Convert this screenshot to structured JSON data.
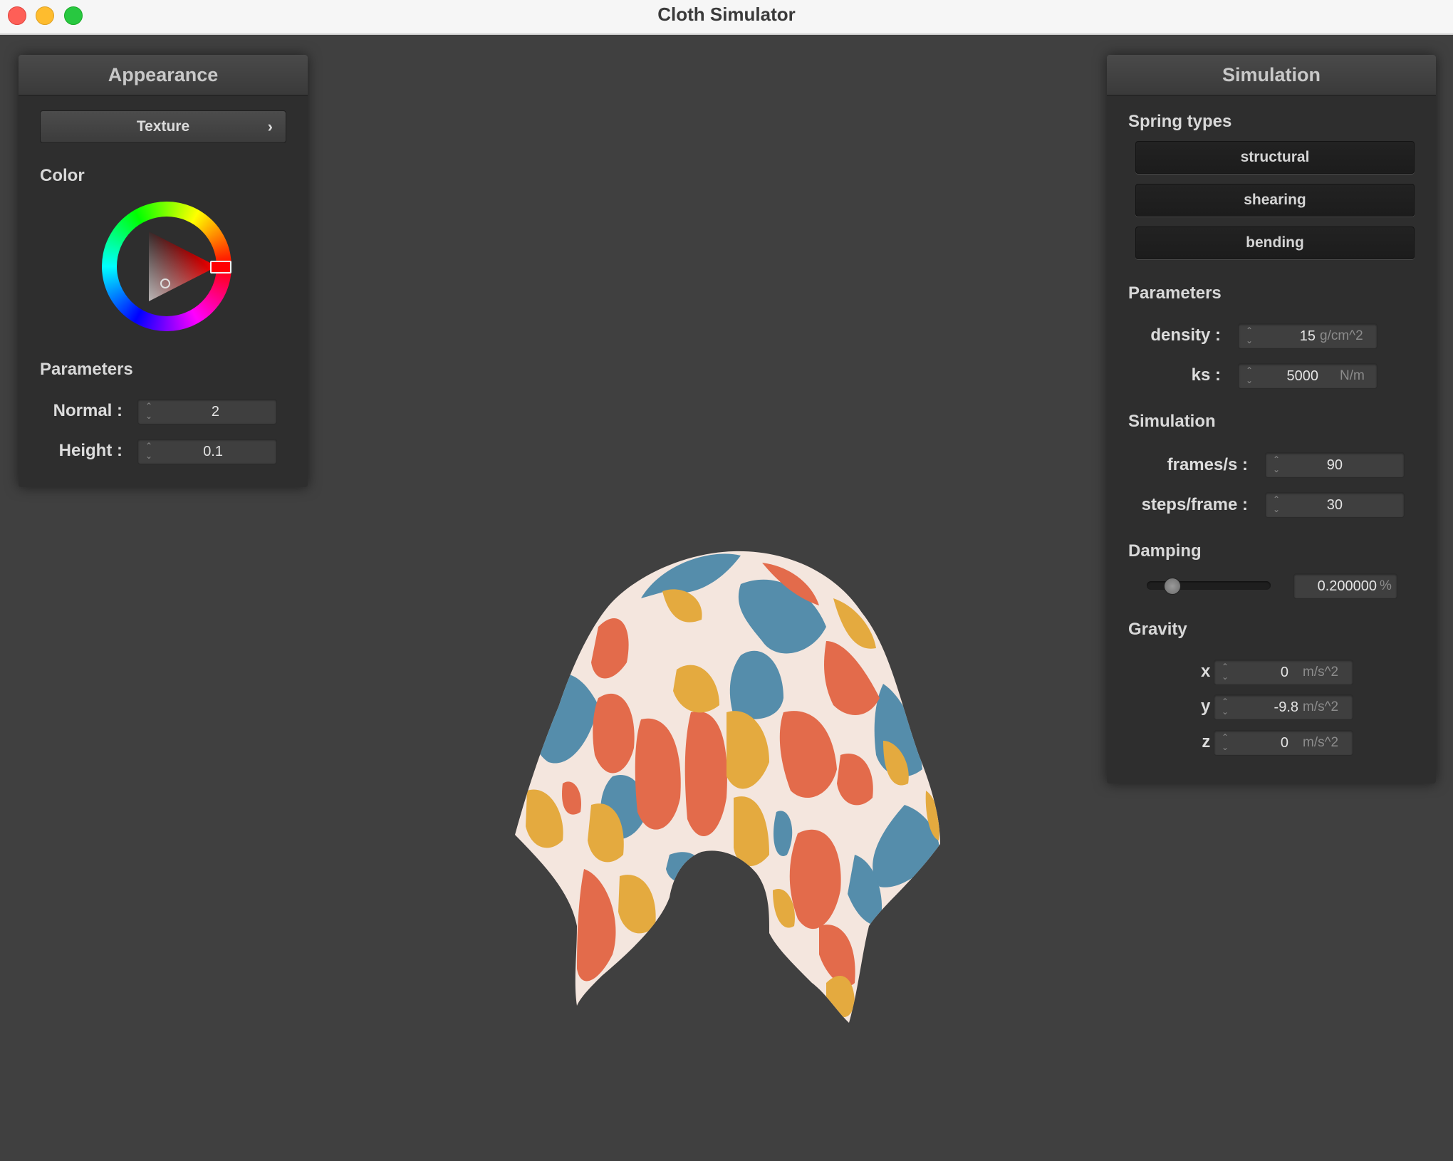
{
  "window": {
    "title": "Cloth Simulator"
  },
  "appearance": {
    "title": "Appearance",
    "texture_button": "Texture",
    "texture_chevron": "›",
    "color_label": "Color",
    "selected_color": "#ff0000",
    "parameters_label": "Parameters",
    "normal": {
      "label": "Normal :",
      "value": "2"
    },
    "height": {
      "label": "Height :",
      "value": "0.1"
    }
  },
  "simulation": {
    "title": "Simulation",
    "spring_types_label": "Spring types",
    "spring_types": [
      "structural",
      "shearing",
      "bending"
    ],
    "parameters_label": "Parameters",
    "density": {
      "label": "density :",
      "value": "15",
      "unit": "g/cm^2"
    },
    "ks": {
      "label": "ks :",
      "value": "5000",
      "unit": "N/m"
    },
    "simulation_label": "Simulation",
    "frames_per_s": {
      "label": "frames/s :",
      "value": "90"
    },
    "steps_per_frame": {
      "label": "steps/frame :",
      "value": "30"
    },
    "damping_label": "Damping",
    "damping": {
      "value": "0.200000",
      "unit": "%",
      "fraction": 0.2
    },
    "gravity_label": "Gravity",
    "gravity": {
      "x": {
        "label": "x :",
        "value": "0",
        "unit": "m/s^2"
      },
      "y": {
        "label": "y :",
        "value": "-9.8",
        "unit": "m/s^2"
      },
      "z": {
        "label": "z :",
        "value": "0",
        "unit": "m/s^2"
      }
    }
  },
  "cloth": {
    "palette": {
      "cream": "#f4e6de",
      "blue": "#558dab",
      "orange": "#e36b4b",
      "yellow": "#e4aa3f"
    }
  }
}
